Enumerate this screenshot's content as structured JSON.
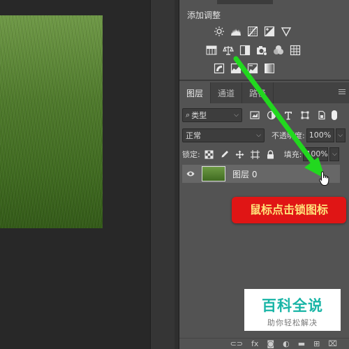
{
  "adjustments": {
    "title": "添加调整",
    "row1": [
      "brightness-icon",
      "levels-icon",
      "curves-icon",
      "exposure-icon",
      "vibrance-icon"
    ],
    "row2": [
      "hue-saturation-icon",
      "color-balance-icon",
      "black-white-icon",
      "photo-filter-icon",
      "channel-mixer-icon",
      "color-lookup-icon"
    ],
    "row3": [
      "invert-icon",
      "posterize-icon",
      "threshold-icon",
      "gradient-map-icon"
    ]
  },
  "layers_panel": {
    "tabs": [
      "图层",
      "通道",
      "路径"
    ],
    "filter": {
      "label": "类型",
      "icon": "search-icon"
    },
    "blend_mode": "正常",
    "opacity_label": "不透明度:",
    "opacity_value": "100%",
    "lock_label": "锁定:",
    "fill_label": "填充:",
    "fill_value": "100%",
    "layers": [
      {
        "name": "图层 0",
        "visible": true
      }
    ],
    "bottom_icons": [
      "link-icon",
      "fx-icon",
      "mask-icon",
      "adjustment-icon",
      "folder-icon",
      "new-layer-icon",
      "trash-icon"
    ],
    "bottom_fx_label": "fx"
  },
  "annotation": {
    "callout": "鼠标点击锁图标",
    "arrow_color": "#22d81f"
  },
  "watermark": {
    "title": "百科全说",
    "subtitle": "助你轻松解决"
  },
  "colors": {
    "panel_bg": "#535353",
    "callout_bg": "#e01515",
    "callout_text": "#ffe27a",
    "watermark_title": "#19b5a6"
  }
}
